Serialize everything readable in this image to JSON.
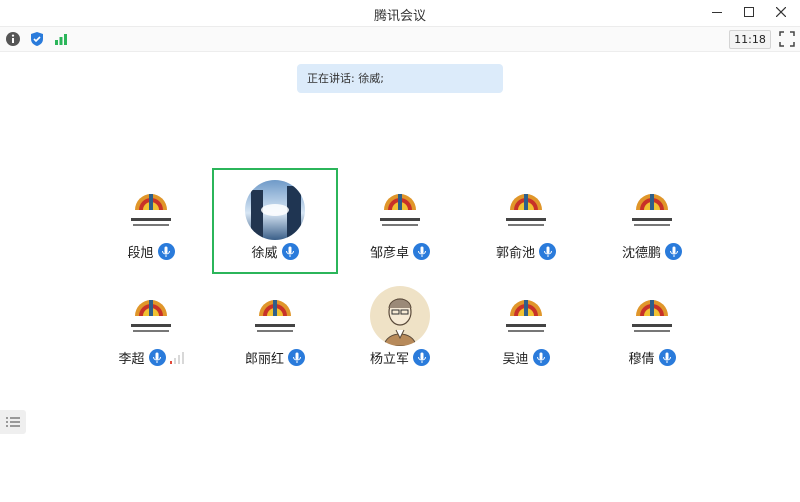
{
  "window": {
    "title": "腾讯会议"
  },
  "toolbar": {
    "time": "11:18"
  },
  "speaking": {
    "text": "正在讲话: 徐威;"
  },
  "participants": [
    {
      "name": "段旭",
      "avatar": "logo",
      "mic": "on"
    },
    {
      "name": "徐威",
      "avatar": "photo-sky",
      "mic": "on",
      "active": true
    },
    {
      "name": "邹彦卓",
      "avatar": "logo",
      "mic": "on"
    },
    {
      "name": "郭俞池",
      "avatar": "logo",
      "mic": "on"
    },
    {
      "name": "沈德鹏",
      "avatar": "logo",
      "mic": "on"
    },
    {
      "name": "李超",
      "avatar": "logo",
      "mic": "on",
      "signal": "weak"
    },
    {
      "name": "郎丽红",
      "avatar": "logo",
      "mic": "on"
    },
    {
      "name": "杨立军",
      "avatar": "photo-sketch",
      "mic": "on"
    },
    {
      "name": "吴迪",
      "avatar": "logo",
      "mic": "on"
    },
    {
      "name": "穆倩",
      "avatar": "logo",
      "mic": "on"
    }
  ],
  "colors": {
    "accent": "#2a7bdb",
    "active_border": "#2bb55a",
    "speaking_bg": "#dcebfa"
  }
}
